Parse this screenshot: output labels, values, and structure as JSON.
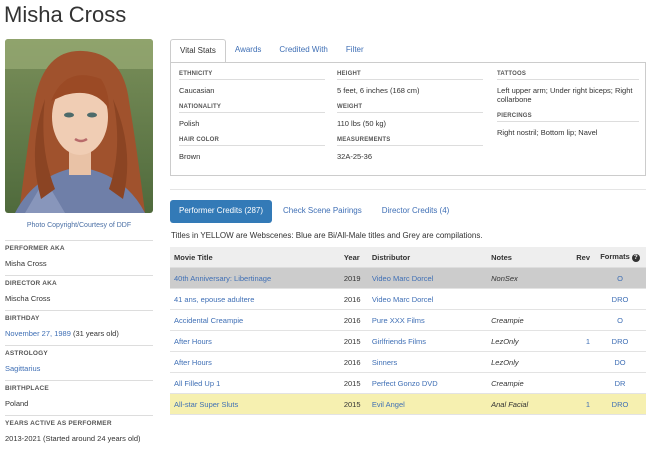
{
  "performer": {
    "name": "Misha Cross",
    "photo_credit": "Photo Copyright/Courtesy of DDF"
  },
  "sidebar": [
    {
      "label": "PERFORMER AKA",
      "value": "Misha Cross",
      "link": false
    },
    {
      "label": "DIRECTOR AKA",
      "value": "Mischa Cross",
      "link": false
    },
    {
      "label": "BIRTHDAY",
      "value": "November 27, 1989",
      "extra": " (31 years old)",
      "link": true
    },
    {
      "label": "ASTROLOGY",
      "value": "Sagittarius",
      "link": true
    },
    {
      "label": "BIRTHPLACE",
      "value": "Poland",
      "link": false
    },
    {
      "label": "YEARS ACTIVE AS PERFORMER",
      "value": "2013-2021 (Started around 24 years old)",
      "link": false
    }
  ],
  "tabs": [
    "Vital Stats",
    "Awards",
    "Credited With",
    "Filter"
  ],
  "vital_stats": {
    "col1": [
      {
        "label": "ETHNICITY",
        "value": "Caucasian"
      },
      {
        "label": "NATIONALITY",
        "value": "Polish"
      },
      {
        "label": "HAIR COLOR",
        "value": "Brown"
      }
    ],
    "col2": [
      {
        "label": "HEIGHT",
        "value": "5 feet, 6 inches (168 cm)"
      },
      {
        "label": "WEIGHT",
        "value": "110 lbs (50 kg)"
      },
      {
        "label": "MEASUREMENTS",
        "value": "32A-25-36"
      }
    ],
    "col3": [
      {
        "label": "TATTOOS",
        "value": "Left upper arm; Under right biceps; Right collarbone"
      },
      {
        "label": "PIERCINGS",
        "value": "Right nostril; Bottom lip; Navel"
      }
    ]
  },
  "credit_tabs": [
    "Performer Credits (287)",
    "Check Scene Pairings",
    "Director Credits (4)"
  ],
  "legend_note": "Titles in YELLOW are Webscenes: Blue are Bi/All-Male titles and Grey are compilations.",
  "table": {
    "headers": {
      "title": "Movie Title",
      "year": "Year",
      "distributor": "Distributor",
      "notes": "Notes",
      "rev": "Rev",
      "formats": "Formats"
    },
    "rows": [
      {
        "title": "40th Anniversary: Libertinage",
        "year": "2019",
        "distributor": "Video Marc Dorcel",
        "notes": "NonSex",
        "rev": "",
        "formats": "O",
        "style": "grey"
      },
      {
        "title": "41 ans, epouse adultere",
        "year": "2016",
        "distributor": "Video Marc Dorcel",
        "notes": "",
        "rev": "",
        "formats": "DRO",
        "style": ""
      },
      {
        "title": "Accidental Creampie",
        "year": "2016",
        "distributor": "Pure XXX Films",
        "notes": "Creampie",
        "rev": "",
        "formats": "O",
        "style": ""
      },
      {
        "title": "After Hours",
        "year": "2015",
        "distributor": "Girlfriends Films",
        "notes": "LezOnly",
        "rev": "1",
        "formats": "DRO",
        "style": ""
      },
      {
        "title": "After Hours",
        "year": "2016",
        "distributor": "Sinners",
        "notes": "LezOnly",
        "rev": "",
        "formats": "DO",
        "style": ""
      },
      {
        "title": "All Filled Up 1",
        "year": "2015",
        "distributor": "Perfect Gonzo DVD",
        "notes": "Creampie",
        "rev": "",
        "formats": "DR",
        "style": ""
      },
      {
        "title": "All-star Super Sluts",
        "year": "2015",
        "distributor": "Evil Angel",
        "notes": "Anal Facial",
        "rev": "1",
        "formats": "DRO",
        "style": "yellow"
      }
    ]
  }
}
